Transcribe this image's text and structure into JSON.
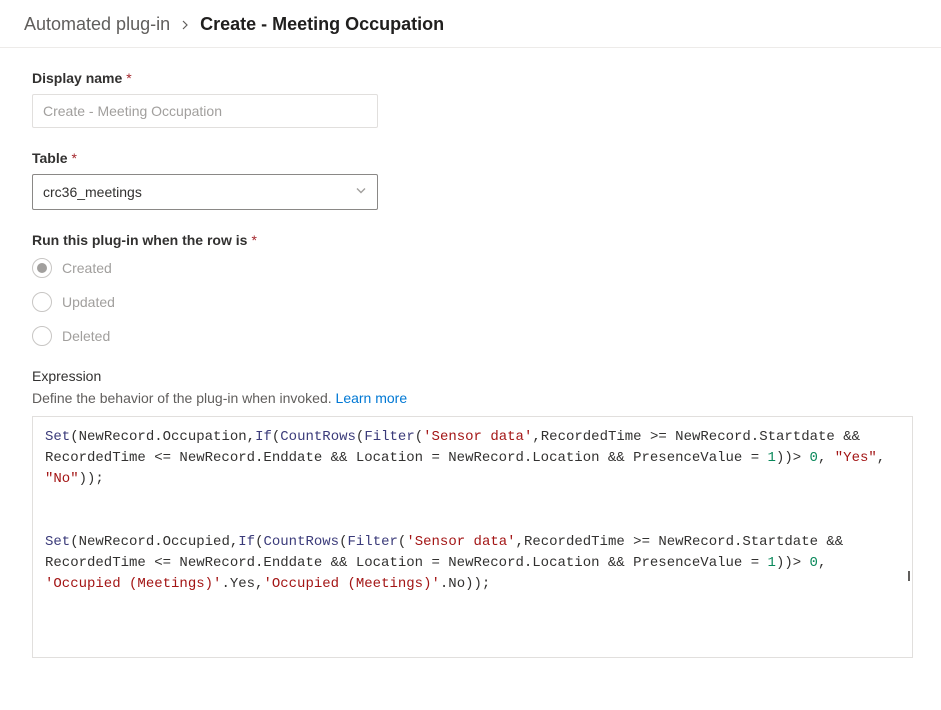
{
  "breadcrumb": {
    "parent": "Automated plug-in",
    "current": "Create - Meeting Occupation"
  },
  "displayName": {
    "label": "Display name",
    "placeholder": "Create - Meeting Occupation",
    "value": ""
  },
  "table": {
    "label": "Table",
    "value": "crc36_meetings"
  },
  "trigger": {
    "label": "Run this plug-in when the row is",
    "options": {
      "created": "Created",
      "updated": "Updated",
      "deleted": "Deleted"
    },
    "selected": "created",
    "disabled": true
  },
  "expression": {
    "heading": "Expression",
    "subtext": "Define the behavior of the plug-in when invoked.",
    "learnMore": "Learn more",
    "code": {
      "line1_a": "(NewRecord.Occupation,",
      "line1_b": "(",
      "line1_c": "(",
      "line1_d": "(",
      "line1_str1": "'Sensor data'",
      "line1_e": ",RecordedTime >= NewRecord.Startdate && RecordedTime <= NewRecord.Enddate && Location = NewRecord.Location && PresenceValue = ",
      "line1_num1": "1",
      "line1_f": "))> ",
      "line1_num2": "0",
      "line1_g": ", ",
      "line1_str2": "\"Yes\"",
      "line1_h": ", ",
      "line1_str3": "\"No\"",
      "line1_i": "));",
      "line2_a": "(NewRecord.Occupied,",
      "line2_b": "(",
      "line2_c": "(",
      "line2_d": "(",
      "line2_str1": "'Sensor data'",
      "line2_e": ",RecordedTime >= NewRecord.Startdate && RecordedTime <= NewRecord.Enddate && Location = NewRecord.Location && PresenceValue = ",
      "line2_num1": "1",
      "line2_f": "))> ",
      "line2_num2": "0",
      "line2_g": ", ",
      "line2_str2": "'Occupied (Meetings)'",
      "line2_h": ".Yes,",
      "line2_str3": "'Occupied (Meetings)'",
      "line2_i": ".No));",
      "fn_set": "Set",
      "fn_if": "If",
      "fn_countrows": "CountRows",
      "fn_filter": "Filter"
    }
  }
}
